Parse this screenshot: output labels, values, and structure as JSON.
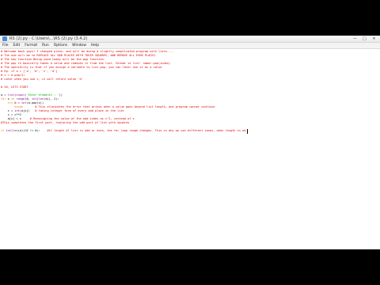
{
  "window": {
    "title": "RS (2).py - C:\\Users\\...\\RS (2).py (3.4.2)",
    "controls": {
      "minimize": "—",
      "maximize": "□",
      "close": "✕"
    }
  },
  "menubar": {
    "items": [
      "File",
      "Edit",
      "Format",
      "Run",
      "Options",
      "Window",
      "Help"
    ]
  },
  "editor": {
    "lines": [
      [
        {
          "c": "comment",
          "t": "# Welcome back guys! I changed plans, and will be doing a slightly complicated program with lists...."
        }
      ],
      [
        {
          "c": "comment",
          "t": "# The aim will be to REPLACE ALL ODD PLACES WITH THEIR SQUARES, AND REMOVE ALL EVEN PLACES."
        }
      ],
      [
        {
          "c": "comment",
          "t": "# The new function Being used today will be the pop function."
        }
      ],
      [
        {
          "c": "comment",
          "t": "# The pop fn basically takes a value and removes it from the list. Format is list' name>.pop(index)"
        }
      ],
      [
        {
          "c": "comment",
          "t": "# The speciality is that if you assign a variable to list.pop, you can later use it as a value"
        }
      ],
      [
        {
          "c": "comment",
          "t": "# Eg. if a = ['a', 'b', 'c', 'd']"
        }
      ],
      [
        {
          "c": "comment",
          "t": "# c = a.pop(3)"
        }
      ],
      [
        {
          "c": "comment",
          "t": "# Later when you use c, it will return value 'd'"
        }
      ],
      [],
      [
        {
          "c": "comment",
          "t": "# SO, LETS START"
        }
      ],
      [],
      [
        {
          "c": "plain",
          "t": "a = "
        },
        {
          "c": "builtin",
          "t": "list"
        },
        {
          "c": "plain",
          "t": "("
        },
        {
          "c": "builtin",
          "t": "input"
        },
        {
          "c": "plain",
          "t": "("
        },
        {
          "c": "string",
          "t": "'Enter elements : '"
        },
        {
          "c": "plain",
          "t": "))"
        }
      ],
      [
        {
          "c": "keyword",
          "t": "for"
        },
        {
          "c": "plain",
          "t": " x "
        },
        {
          "c": "keyword",
          "t": "in"
        },
        {
          "c": "plain",
          "t": " "
        },
        {
          "c": "builtin",
          "t": "range"
        },
        {
          "c": "plain",
          "t": "(0, "
        },
        {
          "c": "builtin",
          "t": "int"
        },
        {
          "c": "plain",
          "t": "("
        },
        {
          "c": "builtin",
          "t": "len"
        },
        {
          "c": "plain",
          "t": "(a)), 2):"
        }
      ],
      [
        {
          "c": "plain",
          "t": "    "
        },
        {
          "c": "keyword",
          "t": "try"
        },
        {
          "c": "plain",
          "t": " b = "
        },
        {
          "c": "builtin",
          "t": "int"
        },
        {
          "c": "plain",
          "t": "(a.pop(x))"
        }
      ],
      [
        {
          "c": "plain",
          "t": "        "
        },
        {
          "c": "keyword",
          "t": "break"
        },
        {
          "c": "plain",
          "t": "       "
        },
        {
          "c": "comment",
          "t": "# This eliminates the error that arises when a value goes beyond list length, and program cannot continue"
        }
      ],
      [
        {
          "c": "plain",
          "t": "    c = "
        },
        {
          "c": "builtin",
          "t": "int"
        },
        {
          "c": "plain",
          "t": "(a[x])   "
        },
        {
          "c": "comment",
          "t": "# taking integer form of every odd place in the list"
        }
      ],
      [
        {
          "c": "plain",
          "t": "    c = c**2"
        }
      ],
      [
        {
          "c": "plain",
          "t": "    a[x] = c     "
        },
        {
          "c": "comment",
          "t": "# Reassigning the value of the odd index as c^2, instead of c"
        }
      ],
      [
        {
          "c": "comment",
          "t": "#This completes the first part, replacing the odd part of list with squares"
        }
      ],
      [],
      [
        {
          "c": "keyword",
          "t": "if"
        },
        {
          "c": "plain",
          "t": " "
        },
        {
          "c": "builtin",
          "t": "int"
        },
        {
          "c": "plain",
          "t": "("
        },
        {
          "c": "builtin",
          "t": "len"
        },
        {
          "c": "plain",
          "t": "(a))%2 != 0):    "
        },
        {
          "c": "comment",
          "t": "#if length of list is odd or even, the for loop range changes. This is why we use different cases, when length is od"
        }
      ]
    ]
  }
}
